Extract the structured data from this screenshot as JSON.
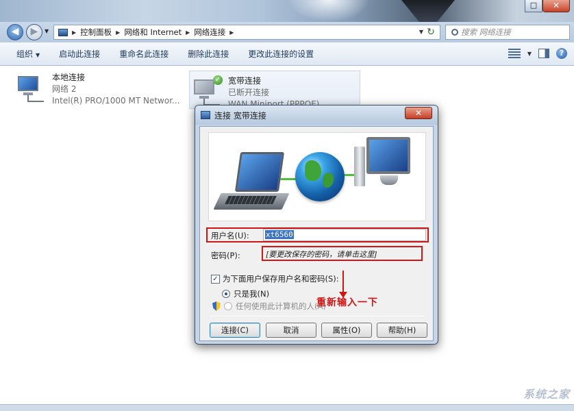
{
  "window": {
    "close_glyph": "✕",
    "maximize_glyph": "□"
  },
  "addressbar": {
    "back_glyph": "◀",
    "forward_glyph": "▶",
    "breadcrumbs": [
      "控制面板",
      "网络和 Internet",
      "网络连接"
    ],
    "search_placeholder": "搜索 网络连接",
    "refresh_glyph": "↻"
  },
  "toolbar": {
    "organize": "组织",
    "start_connection": "启动此连接",
    "rename": "重命名此连接",
    "delete": "删除此连接",
    "change_settings": "更改此连接的设置",
    "help_glyph": "?"
  },
  "connections": [
    {
      "name": "本地连接",
      "status": "网络  2",
      "device": "Intel(R) PRO/1000 MT Networ..."
    },
    {
      "name": "宽带连接",
      "status": "已断开连接",
      "device": "WAN Miniport (PPPOE)"
    }
  ],
  "dialog": {
    "title": "连接 宽带连接",
    "close_glyph": "✕",
    "username_label": "用户名(U):",
    "username_value": "xt6560",
    "password_label": "密码(P):",
    "password_note": "[要更改保存的密码，请单击这里]",
    "save_checkbox_label": "为下面用户保存用户名和密码(S):",
    "save_checked": true,
    "radio_me_only": "只是我(N)",
    "radio_anyone": "任何使用此计算机的人(A)",
    "annotation": "重新输入一下",
    "buttons": {
      "connect": "连接(C)",
      "cancel": "取消",
      "properties": "属性(O)",
      "help": "帮助(H)"
    }
  },
  "watermark": "系统之家",
  "colors": {
    "annotation_red": "#d01515",
    "link_blue": "#1e395b"
  }
}
